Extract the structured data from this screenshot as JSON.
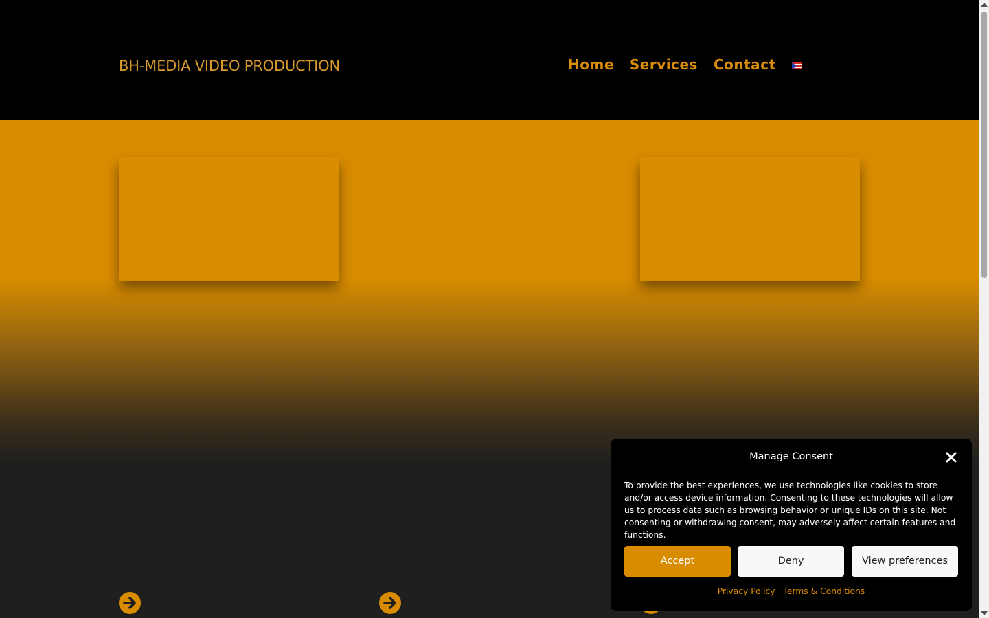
{
  "header": {
    "logo": "BH-MEDIA VIDEO PRODUCTION",
    "nav": [
      "Home",
      "Services",
      "Contact"
    ],
    "language_flag": "puerto-rico-flag-icon"
  },
  "colors": {
    "accent": "#d98c00",
    "header_bg": "#000000",
    "page_bg": "#1f1f1f"
  },
  "hero": {
    "cards": [
      "card-left",
      "card-right"
    ]
  },
  "consent": {
    "title": "Manage Consent",
    "text": "To provide the best experiences, we use technologies like cookies to store and/or access device information. Consenting to these technologies will allow us to process data such as browsing behavior or unique IDs on this site. Not consenting or withdrawing consent, may adversely affect certain features and functions.",
    "accept_label": "Accept",
    "deny_label": "Deny",
    "preferences_label": "View preferences",
    "privacy_link": "Privacy Policy",
    "terms_link": "Terms & Conditions"
  }
}
